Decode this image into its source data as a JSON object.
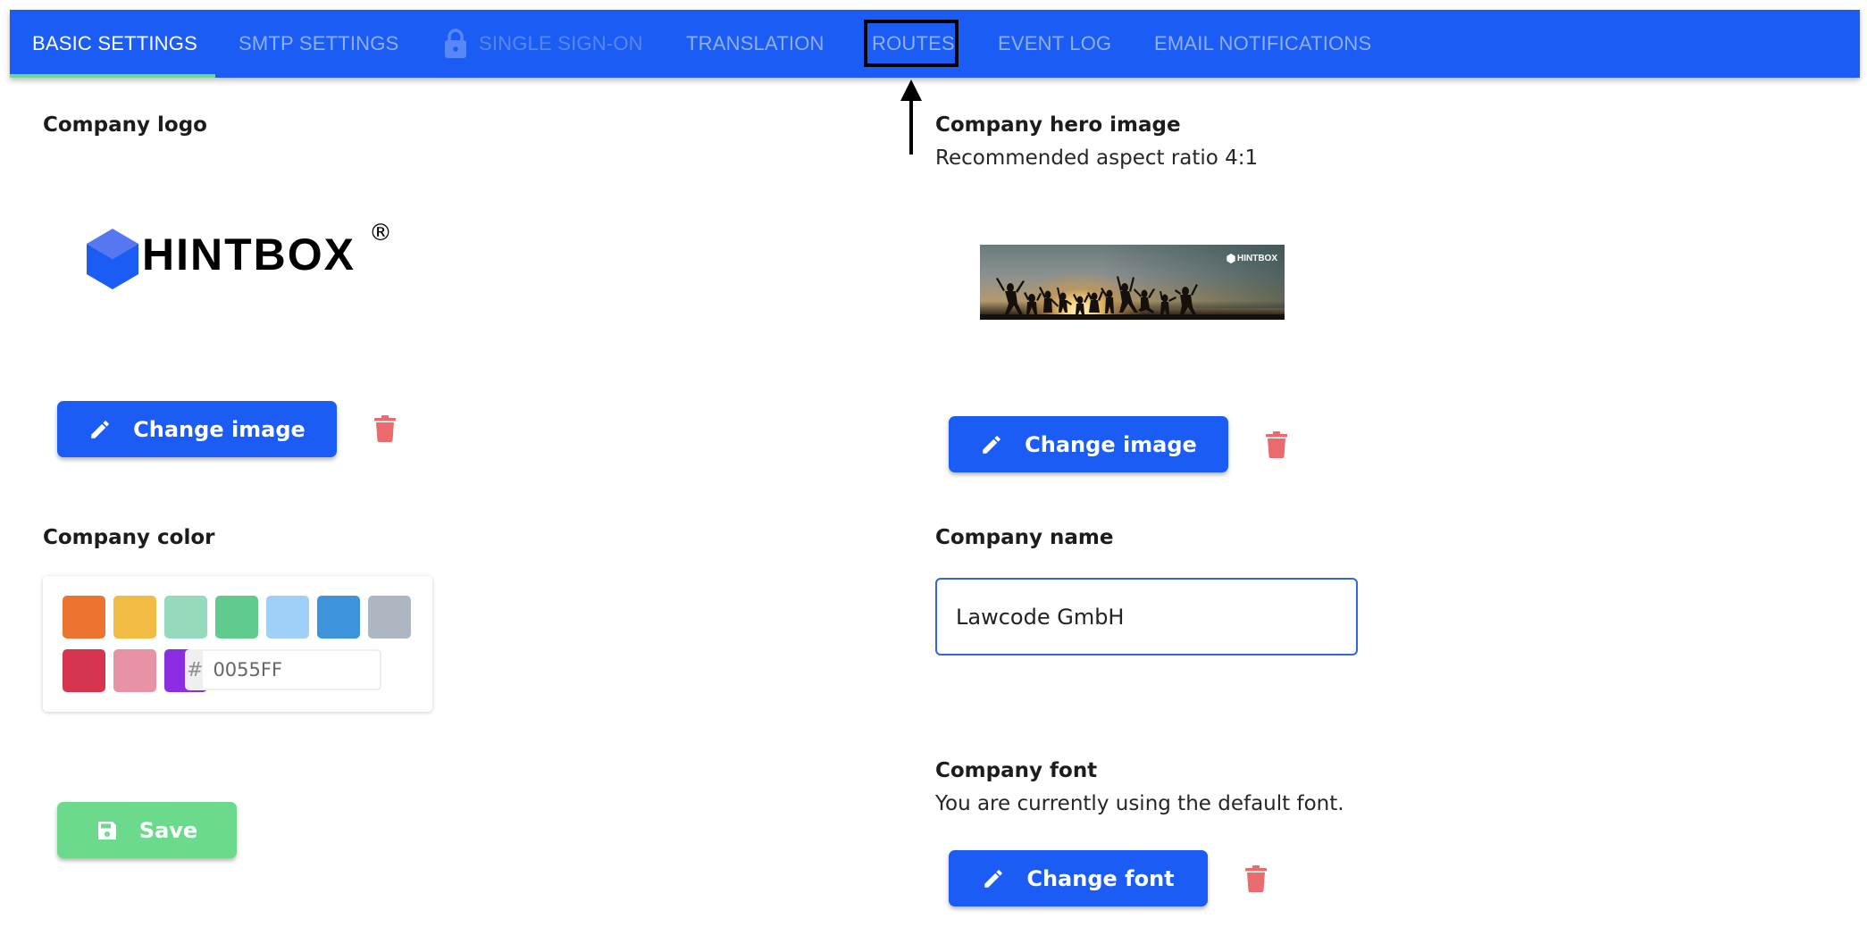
{
  "nav": {
    "tabs": [
      {
        "label": "BASIC SETTINGS",
        "state": "active"
      },
      {
        "label": "SMTP SETTINGS",
        "state": "normal"
      },
      {
        "label": "SINGLE SIGN-ON",
        "state": "disabled",
        "icon": "lock-icon"
      },
      {
        "label": "TRANSLATION",
        "state": "normal"
      },
      {
        "label": "ROUTES",
        "state": "normal",
        "highlighted": true
      },
      {
        "label": "EVENT LOG",
        "state": "normal"
      },
      {
        "label": "EMAIL NOTIFICATIONS",
        "state": "normal"
      }
    ],
    "colors": {
      "bar": "#1a5cf4",
      "active_underline": "#6ed68f"
    }
  },
  "logo_section": {
    "label": "Company logo",
    "logo_text": "HINTBOX",
    "logo_registered": "®",
    "change_button": "Change image",
    "delete_icon": "trash-icon"
  },
  "color_section": {
    "label": "Company color",
    "swatches": [
      "#ED7430",
      "#F2BB44",
      "#95DBBB",
      "#5FCB8C",
      "#9FD0F8",
      "#3E94DC",
      "#ADB7C1",
      "#D7344F",
      "#E892A6",
      "#8C2DE4"
    ],
    "hex_prefix": "#",
    "hex_value": "0055FF"
  },
  "save_button": {
    "label": "Save",
    "icon": "floppy-disk-icon"
  },
  "hero_section": {
    "label": "Company hero image",
    "subtitle": "Recommended aspect ratio 4:1",
    "hero_brand": "HINTBOX",
    "change_button": "Change image",
    "delete_icon": "trash-icon"
  },
  "name_section": {
    "label": "Company name",
    "value": "Lawcode GmbH"
  },
  "font_section": {
    "label": "Company font",
    "subtitle": "You are currently using the default font.",
    "change_button": "Change font",
    "delete_icon": "trash-icon"
  }
}
